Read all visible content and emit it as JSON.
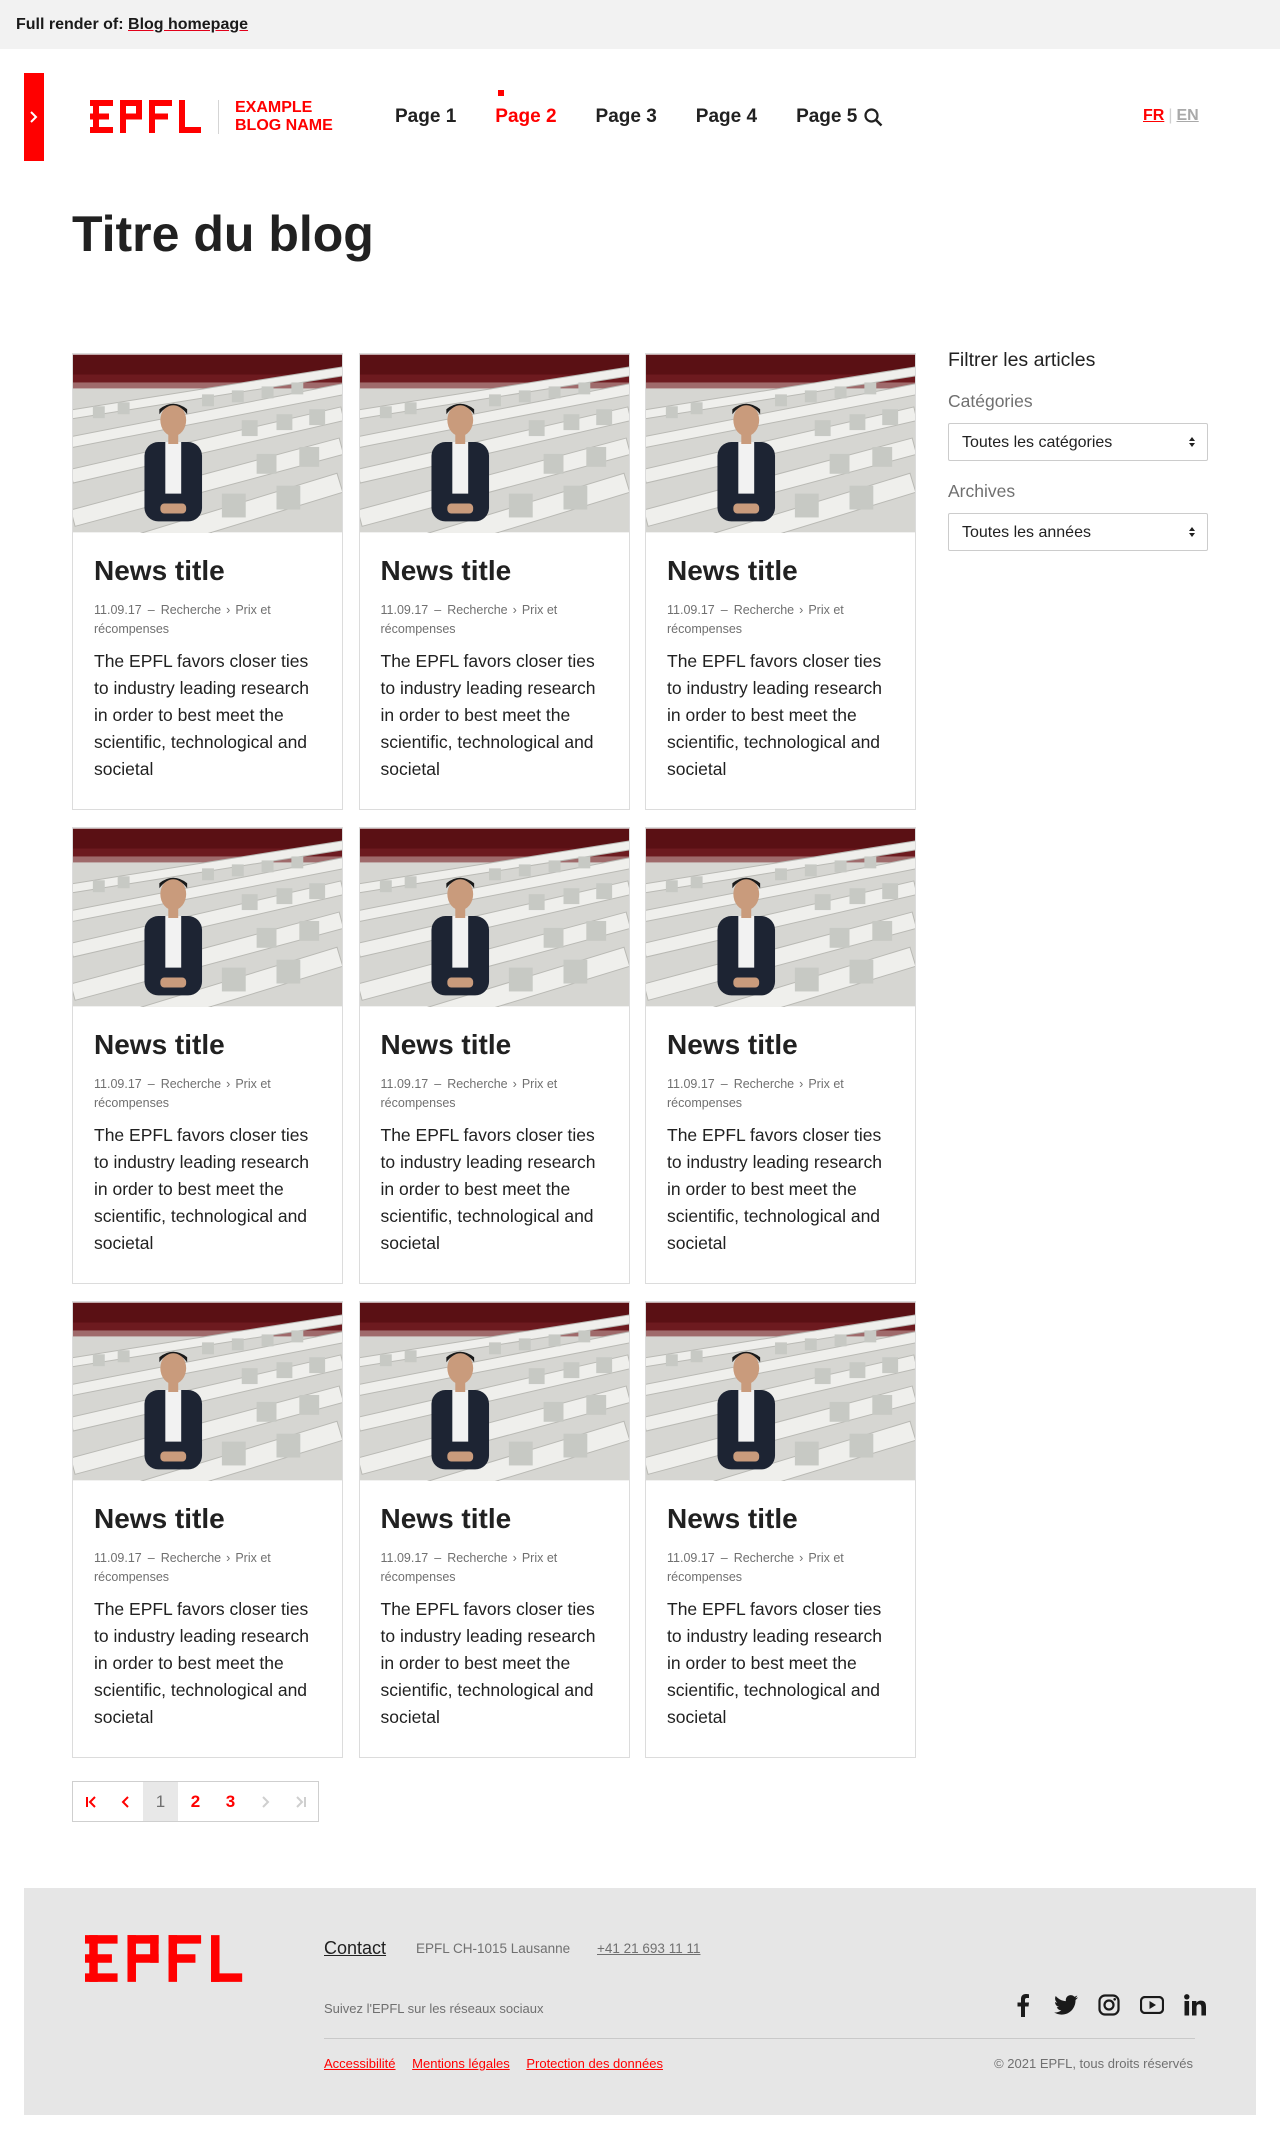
{
  "render_bar": {
    "prefix": "Full render of:",
    "link": "Blog homepage"
  },
  "header": {
    "site_name_line1": "EXAMPLE",
    "site_name_line2": "BLOG NAME",
    "nav": [
      "Page 1",
      "Page 2",
      "Page 3",
      "Page 4",
      "Page 5"
    ],
    "active_nav": "Page 2",
    "lang": {
      "fr": "FR",
      "en": "EN",
      "active": "FR"
    }
  },
  "page": {
    "title": "Titre du blog"
  },
  "cards": [
    {
      "title": "News title",
      "date": "11.09.17",
      "category": "Recherche",
      "subcategory": "Prix et récompenses",
      "excerpt": "The EPFL favors closer ties to industry leading research in order to best meet the scientific, technological and societal"
    },
    {
      "title": "News title",
      "date": "11.09.17",
      "category": "Recherche",
      "subcategory": "Prix et récompenses",
      "excerpt": "The EPFL favors closer ties to industry leading research in order to best meet the scientific, technological and societal"
    },
    {
      "title": "News title",
      "date": "11.09.17",
      "category": "Recherche",
      "subcategory": "Prix et récompenses",
      "excerpt": "The EPFL favors closer ties to industry leading research in order to best meet the scientific, technological and societal"
    },
    {
      "title": "News title",
      "date": "11.09.17",
      "category": "Recherche",
      "subcategory": "Prix et récompenses",
      "excerpt": "The EPFL favors closer ties to industry leading research in order to best meet the scientific, technological and societal"
    },
    {
      "title": "News title",
      "date": "11.09.17",
      "category": "Recherche",
      "subcategory": "Prix et récompenses",
      "excerpt": "The EPFL favors closer ties to industry leading research in order to best meet the scientific, technological and societal"
    },
    {
      "title": "News title",
      "date": "11.09.17",
      "category": "Recherche",
      "subcategory": "Prix et récompenses",
      "excerpt": "The EPFL favors closer ties to industry leading research in order to best meet the scientific, technological and societal"
    },
    {
      "title": "News title",
      "date": "11.09.17",
      "category": "Recherche",
      "subcategory": "Prix et récompenses",
      "excerpt": "The EPFL favors closer ties to industry leading research in order to best meet the scientific, technological and societal"
    },
    {
      "title": "News title",
      "date": "11.09.17",
      "category": "Recherche",
      "subcategory": "Prix et récompenses",
      "excerpt": "The EPFL favors closer ties to industry leading research in order to best meet the scientific, technological and societal"
    },
    {
      "title": "News title",
      "date": "11.09.17",
      "category": "Recherche",
      "subcategory": "Prix et récompenses",
      "excerpt": "The EPFL favors closer ties to industry leading research in order to best meet the scientific, technological and societal"
    }
  ],
  "sidebar": {
    "title": "Filtrer les articles",
    "categories_label": "Catégories",
    "categories_value": "Toutes les catégories",
    "archives_label": "Archives",
    "archives_value": "Toutes les années"
  },
  "pagination": {
    "pages": [
      "1",
      "2",
      "3"
    ],
    "current": "1"
  },
  "footer": {
    "contact": "Contact",
    "address": "EPFL CH-1015 Lausanne",
    "phone": "+41 21 693 11 11",
    "social_text": "Suivez l'EPFL sur les réseaux sociaux",
    "social": [
      "facebook-icon",
      "twitter-icon",
      "instagram-icon",
      "youtube-icon",
      "linkedin-icon"
    ],
    "links": [
      "Accessibilité",
      "Mentions légales",
      "Protection des données"
    ],
    "copyright": "© 2021 EPFL, tous droits réservés"
  },
  "colors": {
    "accent": "#ff0000",
    "text": "#212121",
    "muted": "#707070",
    "footer_bg": "#e6e6e6"
  }
}
